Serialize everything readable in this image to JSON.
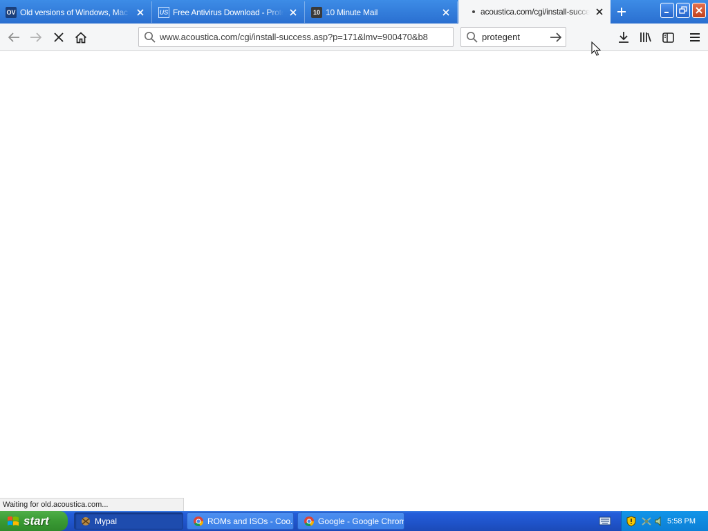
{
  "tabs": [
    {
      "favicon": "OV",
      "title": "Old versions of Windows, Mac and Linux Software",
      "active": false
    },
    {
      "favicon": "US",
      "title": "Free Antivirus Download - Protegent",
      "active": false
    },
    {
      "favicon": "10",
      "title": "10 Minute Mail",
      "active": false
    },
    {
      "favicon": "loading-dot",
      "title": "acoustica.com/cgi/install-success.asp",
      "active": true
    }
  ],
  "toolbar": {
    "url": "www.acoustica.com/cgi/install-success.asp?p=171&lmv=900470&b8",
    "search_value": "protegent"
  },
  "status": {
    "text": "Waiting for old.acoustica.com..."
  },
  "taskbar": {
    "start_label": "start",
    "items": [
      {
        "label": "Mypal",
        "active": true
      },
      {
        "label": "ROMs and ISOs - Coo...",
        "active": false
      },
      {
        "label": "Google - Google Chrome",
        "active": false
      }
    ],
    "clock": "5:58 PM"
  },
  "colors": {
    "tabstrip": "#2a6fd0",
    "taskbar": "#245edb",
    "start_button": "#3a9a34",
    "tray": "#0c7fd6",
    "close_button": "#c1411e"
  }
}
